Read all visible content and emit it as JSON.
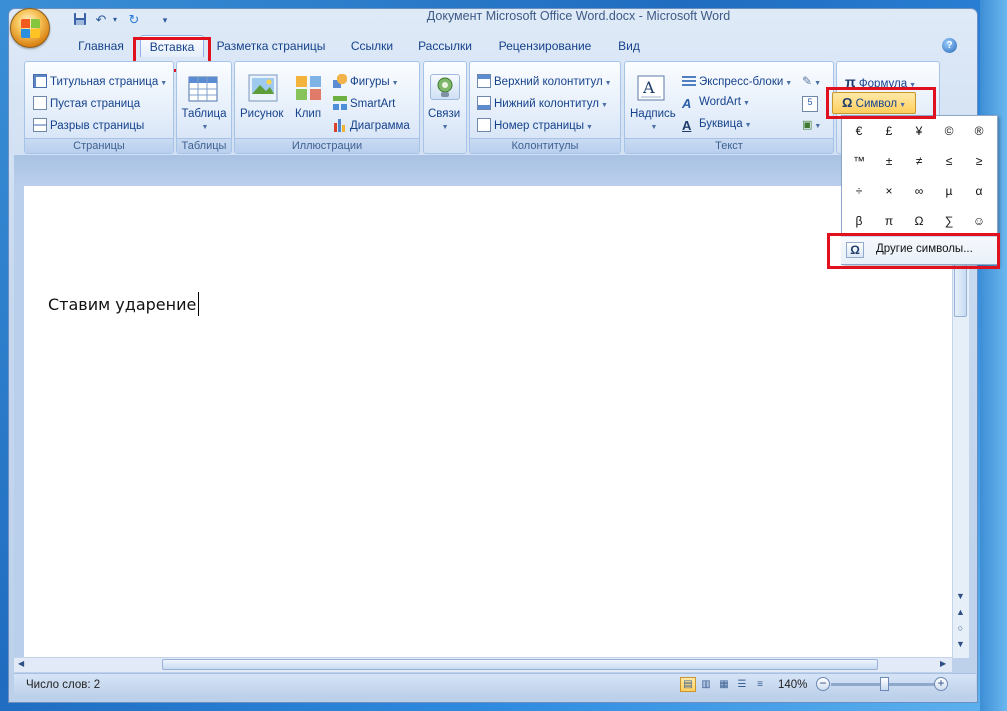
{
  "window": {
    "title": "Документ Microsoft Office Word.docx - Microsoft Word"
  },
  "tabs": [
    {
      "label": "Главная"
    },
    {
      "label": "Вставка"
    },
    {
      "label": "Разметка страницы"
    },
    {
      "label": "Ссылки"
    },
    {
      "label": "Рассылки"
    },
    {
      "label": "Рецензирование"
    },
    {
      "label": "Вид"
    }
  ],
  "ribbon": {
    "pages": {
      "label": "Страницы",
      "items": [
        "Титульная страница",
        "Пустая страница",
        "Разрыв страницы"
      ]
    },
    "tables": {
      "label": "Таблицы",
      "table": "Таблица"
    },
    "illustrations": {
      "label": "Иллюстрации",
      "picture": "Рисунок",
      "clip": "Клип",
      "shapes": "Фигуры",
      "smartart": "SmartArt",
      "chart": "Диаграмма"
    },
    "links": {
      "label": "Связи"
    },
    "headers": {
      "label": "Колонтитулы",
      "items": [
        "Верхний колонтитул",
        "Нижний колонтитул",
        "Номер страницы"
      ]
    },
    "text": {
      "label": "Текст",
      "textbox": "Надпись",
      "quickparts": "Экспресс-блоки",
      "wordart": "WordArt",
      "dropcap": "Буквица"
    },
    "symbols": {
      "equation": "Формула",
      "symbol": "Символ"
    }
  },
  "symbol_menu": {
    "rows": [
      [
        "€",
        "£",
        "¥",
        "©",
        "®"
      ],
      [
        "™",
        "±",
        "≠",
        "≤",
        "≥"
      ],
      [
        "÷",
        "×",
        "∞",
        "µ",
        "α"
      ],
      [
        "β",
        "π",
        "Ω",
        "∑",
        "☺"
      ]
    ],
    "more": "Другие символы..."
  },
  "document": {
    "text": "Ставим ударение"
  },
  "status": {
    "words": "Число слов: 2",
    "zoom": "140%"
  },
  "colors": {
    "highlight": "#e0101e",
    "ribbon_text": "#15428b"
  }
}
